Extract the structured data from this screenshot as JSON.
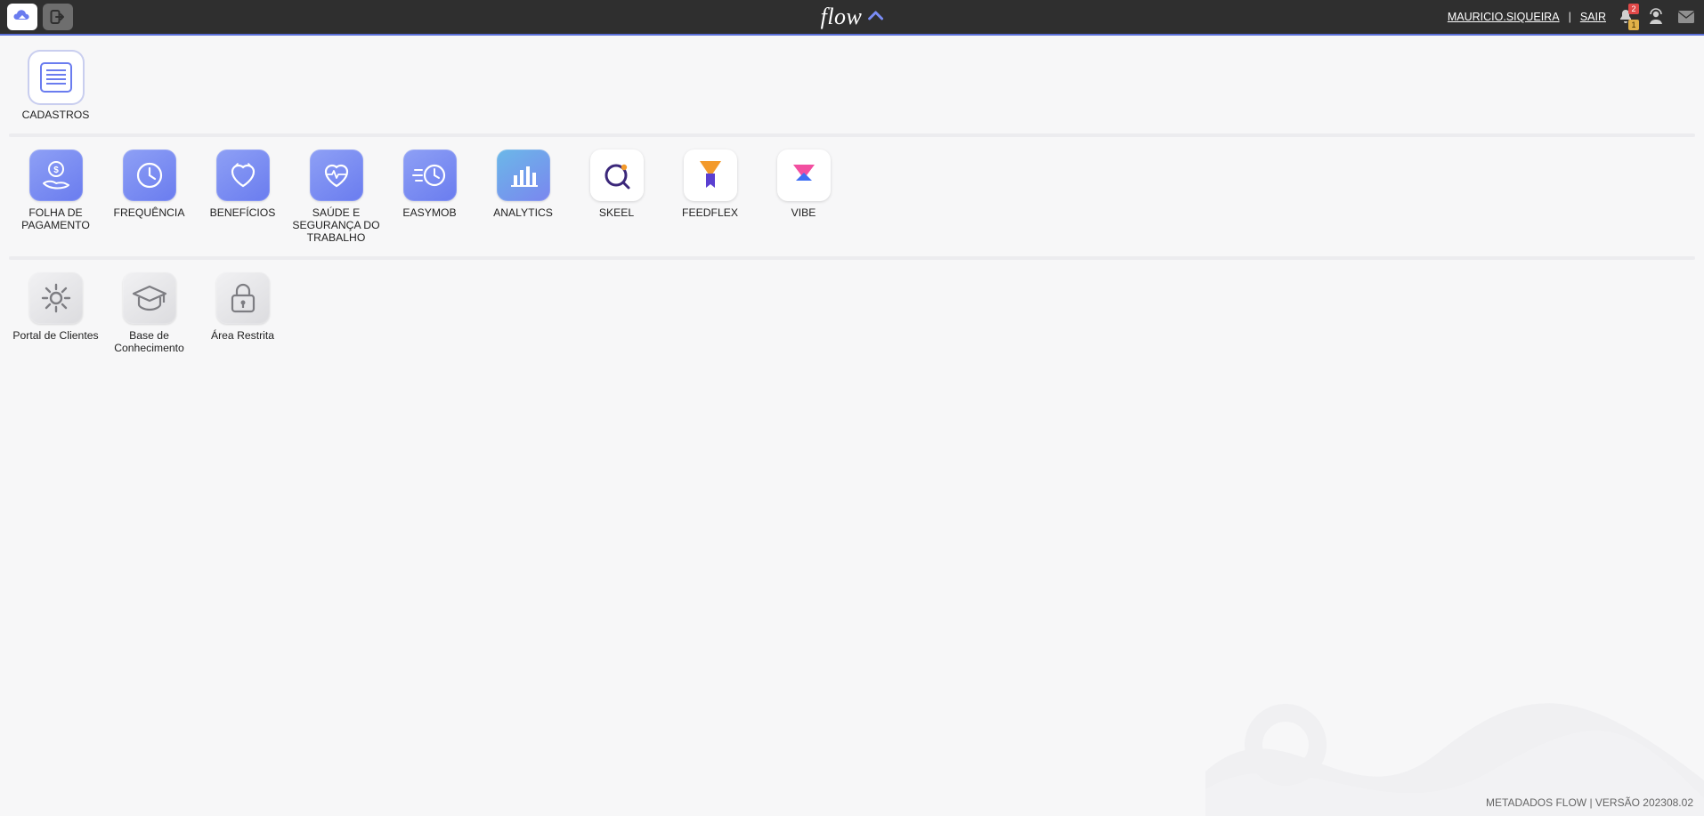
{
  "header": {
    "brand": "flow",
    "user_name": "MAURICIO.SIQUEIRA",
    "logout_label": "SAIR",
    "notifications_count": "2",
    "warnings_count": "1"
  },
  "sections": {
    "a": {
      "items": [
        {
          "id": "cadastros",
          "label": "CADASTROS",
          "icon": "lines",
          "style": "outline-active"
        }
      ]
    },
    "b": {
      "items": [
        {
          "id": "folha-pagamento",
          "label": "FOLHA DE PAGAMENTO",
          "icon": "hand-coin",
          "style": "grad-blue"
        },
        {
          "id": "frequencia",
          "label": "FREQUÊNCIA",
          "icon": "clock",
          "style": "grad-blue"
        },
        {
          "id": "beneficios",
          "label": "BENEFÍCIOS",
          "icon": "heart",
          "style": "grad-blue"
        },
        {
          "id": "saude-seguranca",
          "label": "SAÚDE E SEGURANÇA DO TRABALHO",
          "icon": "heartbeat",
          "style": "grad-blue"
        },
        {
          "id": "easymob",
          "label": "EASYMOB",
          "icon": "fast-clock",
          "style": "grad-blue"
        },
        {
          "id": "analytics",
          "label": "ANALYTICS",
          "icon": "bar-chart",
          "style": "grad-teal"
        },
        {
          "id": "skeel",
          "label": "SKEEL",
          "icon": "skeel",
          "style": "white"
        },
        {
          "id": "feedflex",
          "label": "FEEDFLEX",
          "icon": "feedflex",
          "style": "white"
        },
        {
          "id": "vibe",
          "label": "VIBE",
          "icon": "vibe",
          "style": "white"
        }
      ]
    },
    "c": {
      "items": [
        {
          "id": "portal-clientes",
          "label": "Portal de Clientes",
          "icon": "gear",
          "style": "grey"
        },
        {
          "id": "base-conhecimento",
          "label": "Base de Conhecimento",
          "icon": "graduation",
          "style": "grey"
        },
        {
          "id": "area-restrita",
          "label": "Área Restrita",
          "icon": "lock",
          "style": "grey"
        }
      ]
    }
  },
  "footer": {
    "version_text": "METADADOS FLOW | VERSÃO 202308.02"
  }
}
